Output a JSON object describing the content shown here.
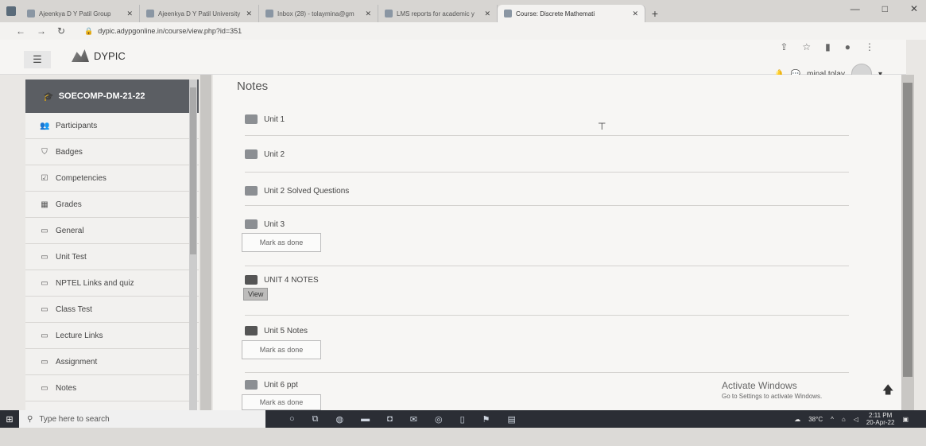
{
  "browser": {
    "tabs": [
      {
        "title": "Ajeenkya D Y Patil Group",
        "active": false
      },
      {
        "title": "Ajeenkya D Y Patil University",
        "active": false
      },
      {
        "title": "Inbox (28) - tolaymina@gm",
        "active": false
      },
      {
        "title": "LMS reports for academic y",
        "active": false
      },
      {
        "title": "Course: Discrete Mathemati",
        "active": true
      }
    ],
    "url": "dypic.adypgonline.in/course/view.php?id=351",
    "new_tab": "+",
    "min": "—",
    "max": "□",
    "close": "✕"
  },
  "site": {
    "brand": "DYPIC",
    "user_name": "minal tolay"
  },
  "sidebar": {
    "course_code": "SOECOMP-DM-21-22",
    "items": [
      {
        "label": "Participants",
        "icon": "users-icon"
      },
      {
        "label": "Badges",
        "icon": "shield-icon"
      },
      {
        "label": "Competencies",
        "icon": "check-icon"
      },
      {
        "label": "Grades",
        "icon": "table-icon"
      },
      {
        "label": "General",
        "icon": "folder-icon"
      },
      {
        "label": "Unit Test",
        "icon": "folder-icon"
      },
      {
        "label": "NPTEL Links and quiz",
        "icon": "folder-icon"
      },
      {
        "label": "Class Test",
        "icon": "folder-icon"
      },
      {
        "label": "Lecture Links",
        "icon": "folder-icon"
      },
      {
        "label": "Assignment",
        "icon": "folder-icon"
      },
      {
        "label": "Notes",
        "icon": "folder-icon"
      }
    ]
  },
  "main": {
    "section_title": "Notes",
    "activities": [
      {
        "label": "Unit 1"
      },
      {
        "label": "Unit 2"
      },
      {
        "label": "Unit 2 Solved Questions"
      },
      {
        "label": "Unit 3"
      },
      {
        "label": "UNIT 4 NOTES"
      },
      {
        "label": "Unit 5 Notes"
      },
      {
        "label": "Unit 6 ppt"
      }
    ],
    "mark_done": "Mark as done",
    "view": "View",
    "activate_title": "Activate Windows",
    "activate_sub": "Go to Settings to activate Windows."
  },
  "taskbar": {
    "search_placeholder": "Type here to search",
    "temperature": "38°C",
    "time": "2:11 PM",
    "date": "20-Apr-22"
  }
}
